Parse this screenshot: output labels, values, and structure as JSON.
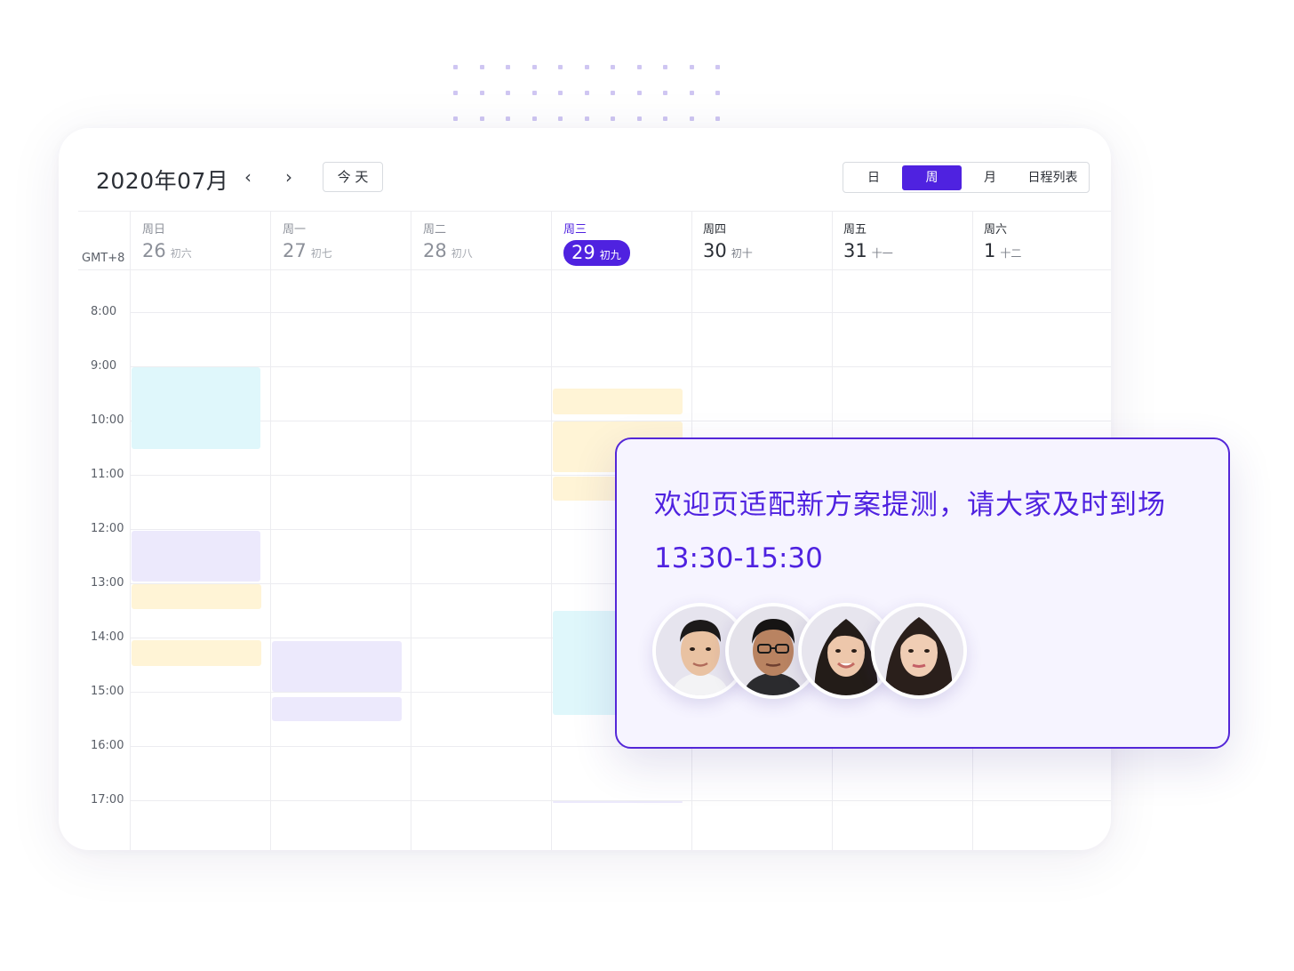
{
  "calendar": {
    "title": "2020年07月",
    "prev_icon": "‹",
    "next_icon": "›",
    "today_label": "今 天",
    "views": [
      {
        "label": "日",
        "active": false
      },
      {
        "label": "周",
        "active": true
      },
      {
        "label": "月",
        "active": false
      },
      {
        "label": "日程列表",
        "active": false
      }
    ],
    "timezone": "GMT+8",
    "days": [
      {
        "name": "周日",
        "num": "26",
        "lunar": "初六"
      },
      {
        "name": "周一",
        "num": "27",
        "lunar": "初七"
      },
      {
        "name": "周二",
        "num": "28",
        "lunar": "初八"
      },
      {
        "name": "周三",
        "num": "29",
        "lunar": "初九"
      },
      {
        "name": "周四",
        "num": "30",
        "lunar": "初十"
      },
      {
        "name": "周五",
        "num": "31",
        "lunar": "十一"
      },
      {
        "name": "周六",
        "num": "1",
        "lunar": "十二"
      }
    ],
    "times": [
      "8:00",
      "9:00",
      "10:00",
      "11:00",
      "12:00",
      "13:00",
      "14:00",
      "15:00",
      "16:00",
      "17:00"
    ]
  },
  "popup": {
    "title": "欢迎页适配新方案提测，请大家及时到场",
    "time": "13:30-15:30"
  },
  "colors": {
    "accent": "#4f22e0",
    "event_cyan": "#dff7fb",
    "event_purple": "#ece9fc",
    "event_yellow": "#fff4d6"
  }
}
